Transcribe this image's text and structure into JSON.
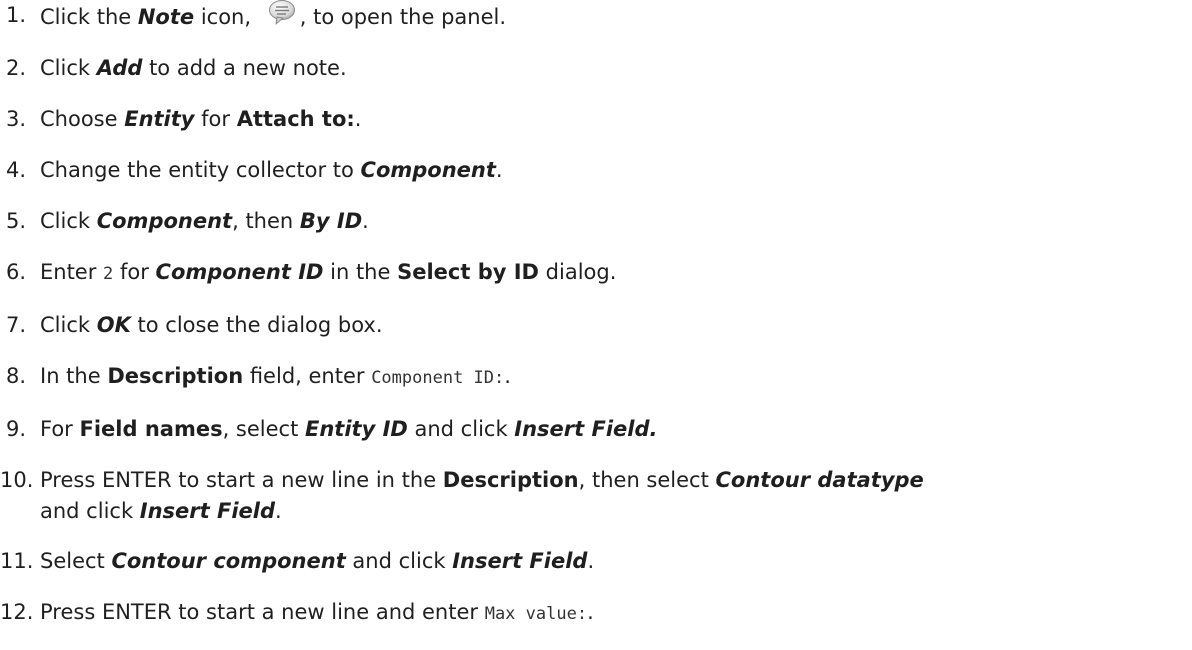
{
  "steps": [
    {
      "num": "1.",
      "parts": [
        "Click the ",
        "Note",
        " icon, ",
        ", to open the panel."
      ],
      "icon": "note-speech-bubble-icon"
    },
    {
      "num": "2.",
      "parts": [
        "Click ",
        "Add",
        " to add a new note."
      ]
    },
    {
      "num": "3.",
      "parts": [
        "Choose ",
        "Entity",
        " for ",
        "Attach to:",
        "."
      ]
    },
    {
      "num": "4.",
      "parts": [
        "Change the entity collector to ",
        "Component",
        "."
      ]
    },
    {
      "num": "5.",
      "parts": [
        "Click ",
        "Component",
        ", then ",
        "By ID",
        "."
      ]
    },
    {
      "num": "6.",
      "parts": [
        "Enter ",
        "2",
        " for ",
        "Component ID",
        " in the ",
        "Select by ID",
        " dialog."
      ]
    },
    {
      "num": "7.",
      "parts": [
        "Click ",
        "OK",
        " to close the dialog box."
      ]
    },
    {
      "num": "8.",
      "parts": [
        "In the ",
        "Description",
        " field, enter ",
        "Component ID:",
        "."
      ]
    },
    {
      "num": "9.",
      "parts": [
        "For ",
        "Field names",
        ", select ",
        "Entity ID",
        " and click ",
        "Insert Field."
      ]
    },
    {
      "num": "10.",
      "parts": [
        "Press ENTER to start a new line in the ",
        "Description",
        ", then select ",
        "Contour datatype",
        " and click ",
        "Insert Field",
        "."
      ]
    },
    {
      "num": "11.",
      "parts": [
        "Select ",
        "Contour component",
        " and click ",
        "Insert Field",
        "."
      ]
    },
    {
      "num": "12.",
      "parts": [
        "Press ENTER to start a new line and enter ",
        "Max value:",
        "."
      ]
    }
  ]
}
